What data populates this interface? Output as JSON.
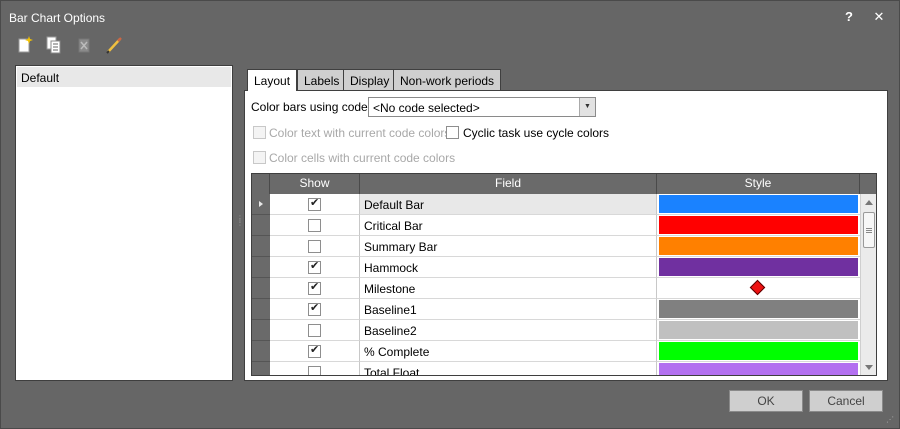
{
  "window": {
    "title": "Bar Chart Options",
    "help_glyph": "?",
    "close_glyph": "✕"
  },
  "toolbar": {
    "icons": [
      "new-icon",
      "copy-icon",
      "delete-icon",
      "edit-icon"
    ]
  },
  "layouts": {
    "items": [
      {
        "label": "Default",
        "selected": true
      }
    ]
  },
  "tabs": [
    {
      "label": "Layout",
      "active": true
    },
    {
      "label": "Labels",
      "active": false
    },
    {
      "label": "Display",
      "active": false
    },
    {
      "label": "Non-work periods",
      "active": false
    }
  ],
  "layout_tab": {
    "color_bars_label": "Color bars using code:",
    "color_bars_value": "<No code selected>",
    "color_text_label": "Color text with current code colors",
    "color_text_checked": false,
    "color_text_enabled": false,
    "cyclic_label": "Cyclic task use cycle colors",
    "cyclic_checked": false,
    "color_cells_label": "Color cells with current code colors",
    "color_cells_checked": false,
    "color_cells_enabled": false
  },
  "grid": {
    "columns": [
      "Show",
      "Field",
      "Style"
    ],
    "rows": [
      {
        "field": "Default Bar",
        "show": true,
        "style_type": "bar",
        "color": "#1a82ff",
        "selected": true
      },
      {
        "field": "Critical Bar",
        "show": false,
        "style_type": "bar",
        "color": "#ff0000",
        "selected": false
      },
      {
        "field": "Summary Bar",
        "show": false,
        "style_type": "bar",
        "color": "#ff8000",
        "selected": false
      },
      {
        "field": "Hammock",
        "show": true,
        "style_type": "bar",
        "color": "#7030a0",
        "selected": false
      },
      {
        "field": "Milestone",
        "show": true,
        "style_type": "diamond",
        "color": "#ee1111",
        "selected": false
      },
      {
        "field": "Baseline1",
        "show": true,
        "style_type": "bar",
        "color": "#808080",
        "selected": false
      },
      {
        "field": "Baseline2",
        "show": false,
        "style_type": "bar",
        "color": "#c0c0c0",
        "selected": false
      },
      {
        "field": "% Complete",
        "show": true,
        "style_type": "bar",
        "color": "#00ff00",
        "selected": false
      },
      {
        "field": "Total Float",
        "show": false,
        "style_type": "bar",
        "color": "#b370f0",
        "selected": false
      }
    ]
  },
  "buttons": {
    "ok": "OK",
    "cancel": "Cancel"
  }
}
